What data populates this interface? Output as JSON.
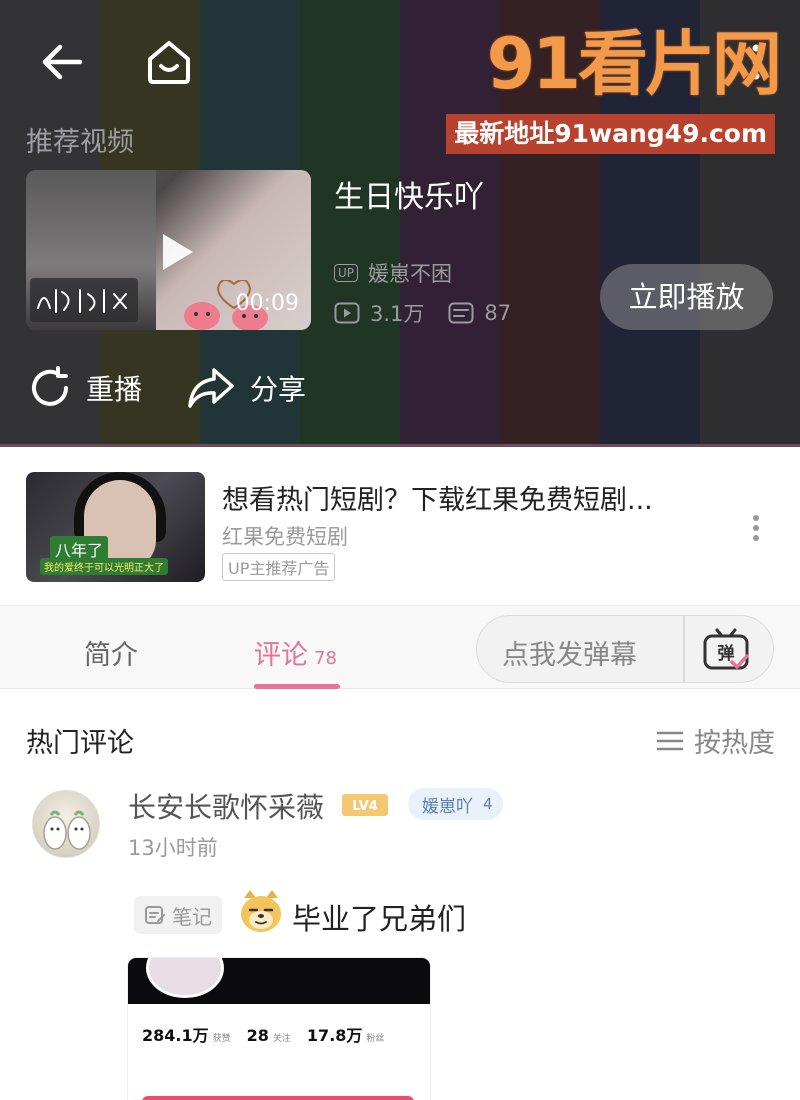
{
  "player": {
    "section_label": "推荐视频",
    "bar_colors": [
      "#7f7f7f",
      "#8a8a2c",
      "#2e8a8a",
      "#2f8a3a",
      "#7a2f7a",
      "#8a2f2f",
      "#2f3a8a",
      "#6a6a6a"
    ],
    "video": {
      "title": "生日快乐吖",
      "duration": "00:09",
      "uploader_badge": "UP",
      "uploader": "媛崽不困",
      "views": "3.1万",
      "danmaku_count": "87",
      "play_now_label": "立即播放"
    },
    "actions": {
      "replay": "重播",
      "share": "分享"
    }
  },
  "watermark": {
    "logo": "91看片网",
    "subtitle": "最新地址91wang49.com"
  },
  "ad": {
    "title": "想看热门短剧？下载红果免费短剧...",
    "source": "红果免费短剧",
    "badge": "UP主推荐广告",
    "thumb_tag": "八年了",
    "thumb_caption": "我的爱终于可以光明正大了"
  },
  "tabs": {
    "intro": "简介",
    "comments": "评论",
    "comments_count": "78",
    "danmaku_placeholder": "点我发弹幕",
    "danmaku_icon_label": "弹"
  },
  "comments": {
    "section_title": "热门评论",
    "sort_label": "按热度",
    "items": [
      {
        "username": "长安长歌怀采薇",
        "level": "LV4",
        "fan_badge": "媛崽吖",
        "fan_level": "4",
        "time": "13小时前",
        "note_tag": "笔记",
        "text": "毕业了兄弟们",
        "screenshot": {
          "stat1_value": "284.1万",
          "stat1_label": "获赞",
          "stat2_value": "28",
          "stat2_label": "关注",
          "stat3_value": "17.8万",
          "stat3_label": "粉丝"
        }
      }
    ]
  },
  "colors": {
    "accent_pink": "#e9729b",
    "watermark_orange": "#f39a4a",
    "watermark_red": "#b8422d"
  }
}
